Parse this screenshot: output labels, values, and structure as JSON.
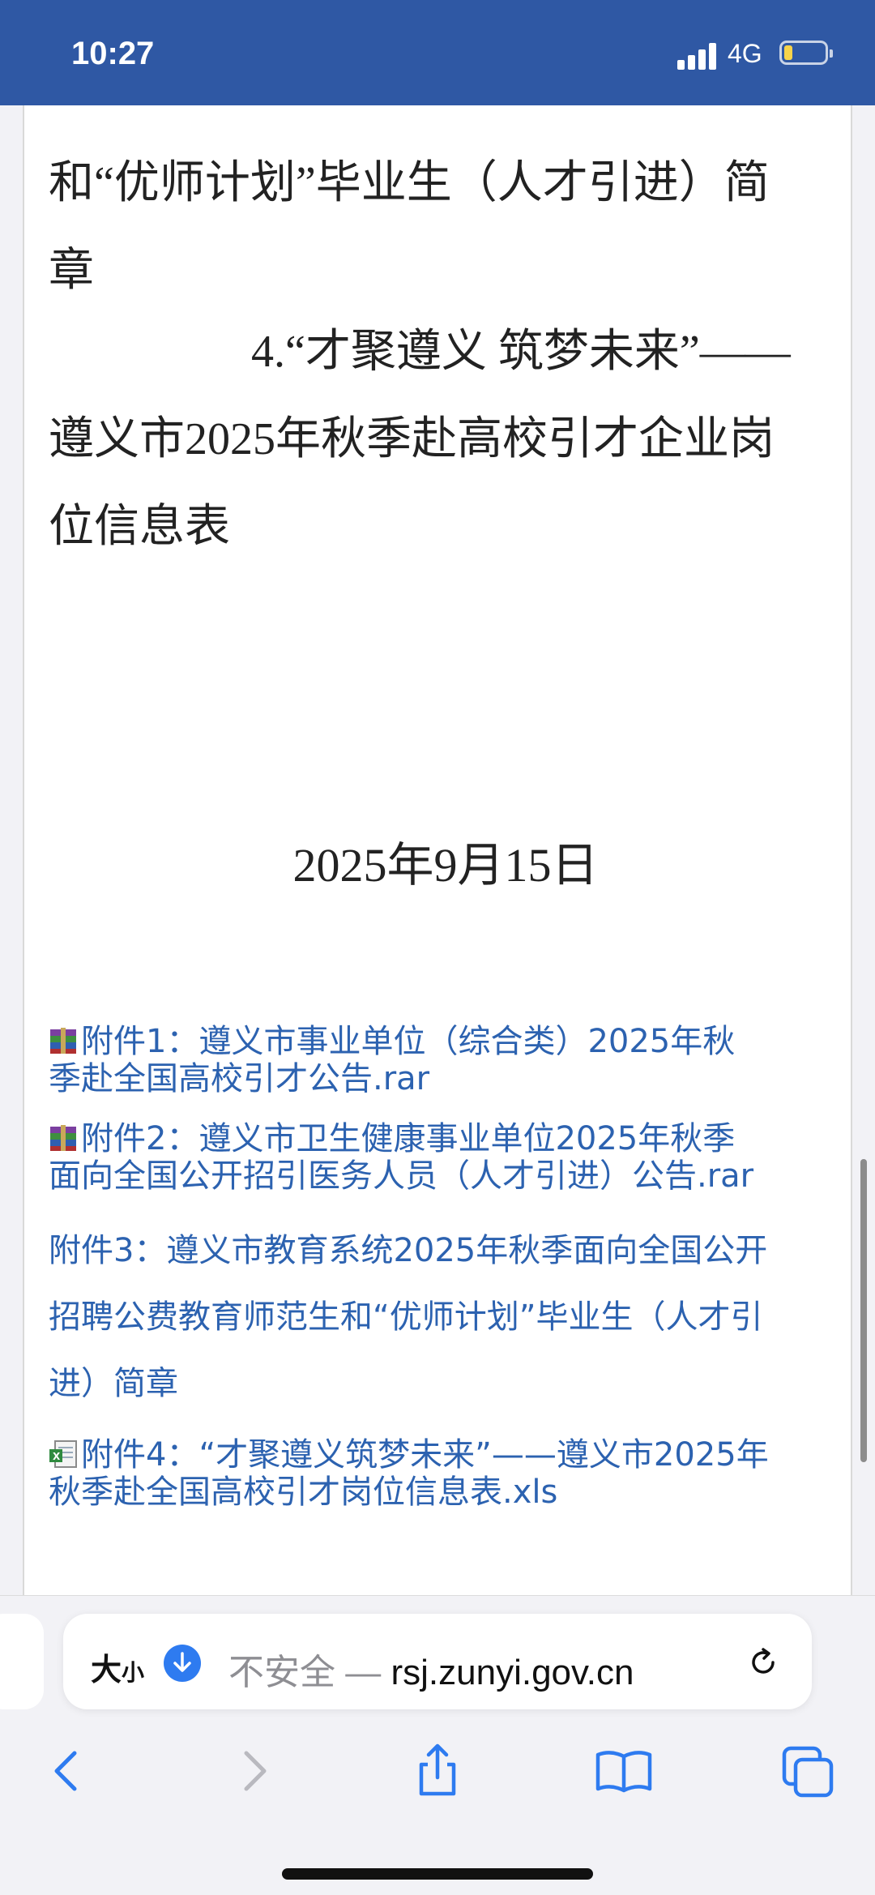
{
  "status_bar": {
    "time": "10:27",
    "network": "4G",
    "battery_color": "#f7d34a",
    "background": "#2f58a4"
  },
  "article": {
    "para_top_line1": "和“优师计划”毕业生（人才引进）简",
    "para_top_line2": "章",
    "item4_line1": "4.“才聚遵义 筑梦未来”——",
    "item4_line2": "遵义市2025年秋季赴高校引才企业岗",
    "item4_line3": "位信息表",
    "date": "2025年9月15日"
  },
  "attachments": [
    {
      "icon": "rar-archive-icon",
      "line1": "附件1：遵义市事业单位（综合类）2025年秋",
      "line2": "季赴全国高校引才公告.rar"
    },
    {
      "icon": "rar-archive-icon",
      "line1": "附件2：遵义市卫生健康事业单位2025年秋季",
      "line2": "面向全国公开招引医务人员（人才引进）公告.rar"
    },
    {
      "line1": "附件3：遵义市教育系统2025年秋季面向全国公开",
      "line2": "招聘公费教育师范生和“优师计划”毕业生（人才引",
      "line3": "进）简章"
    },
    {
      "icon": "excel-file-icon",
      "line1": "附件4：“才聚遵义筑梦未来”——遵义市2025年",
      "line2": "秋季赴全国高校引才岗位信息表.xls"
    }
  ],
  "address_bar": {
    "font_size_label": "大",
    "font_size_small": "小",
    "insecure_label": "不安全 —",
    "domain": "rsj.zunyi.gov.cn",
    "accent": "#2e7bf0"
  },
  "toolbar": {
    "icons": [
      "back-icon",
      "forward-icon",
      "share-icon",
      "bookmarks-icon",
      "tabs-icon"
    ]
  },
  "link_color": "#2c62b0"
}
